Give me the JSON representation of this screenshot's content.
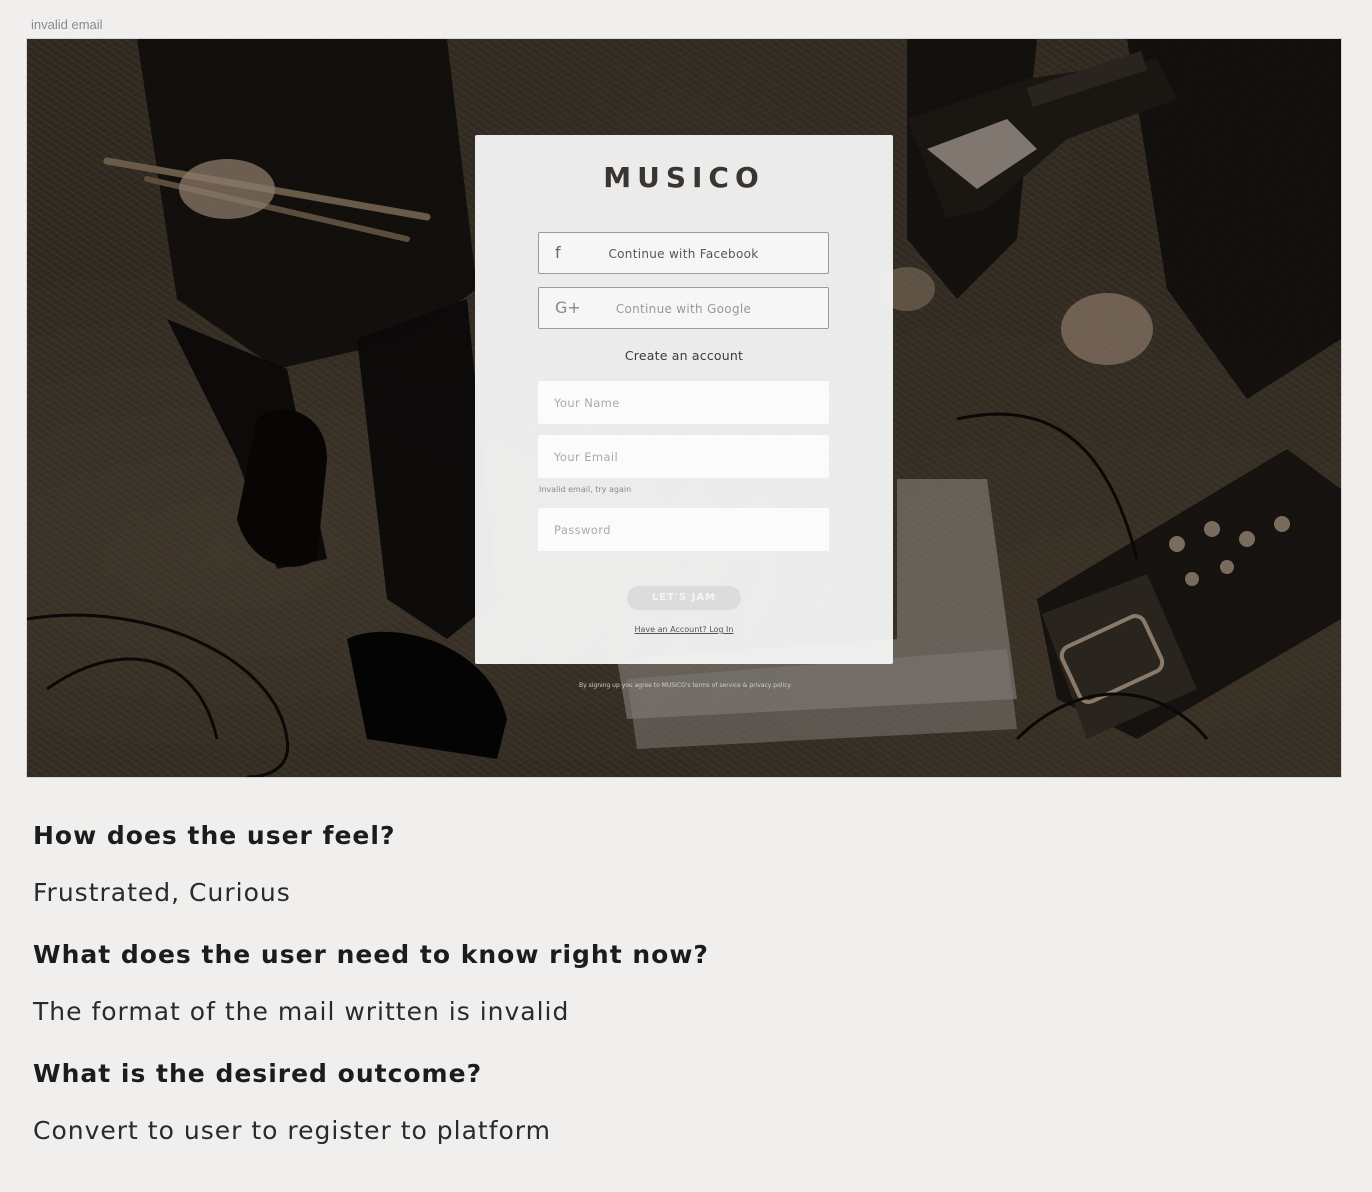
{
  "frame": {
    "label": "invalid email"
  },
  "modal": {
    "logo": "MUSICO",
    "facebook_button": "Continue with Facebook",
    "facebook_icon": "f",
    "google_button": "Continue with Google",
    "google_icon": "G+",
    "create_account": "Create an account",
    "name_placeholder": "Your Name",
    "email_placeholder": "Your Email",
    "email_error": "Invalid email, try again",
    "password_placeholder": "Password",
    "submit_label": "LET'S JAM",
    "login_link": "Have an Account? Log In",
    "terms": "By signing up you agree to MUSICO's terms of service & privacy policy"
  },
  "notes": [
    {
      "question": "How does the user feel?",
      "answer": "Frustrated, Curious"
    },
    {
      "question": "What does the user need to know right now?",
      "answer": "The format of the mail written is invalid"
    },
    {
      "question": "What is the desired outcome?",
      "answer": "Convert to user to register to platform"
    }
  ],
  "colors": {
    "page_bg": "#f0efee",
    "photo_bg": "#2e2820",
    "modal_bg": "#f4f4f4"
  }
}
